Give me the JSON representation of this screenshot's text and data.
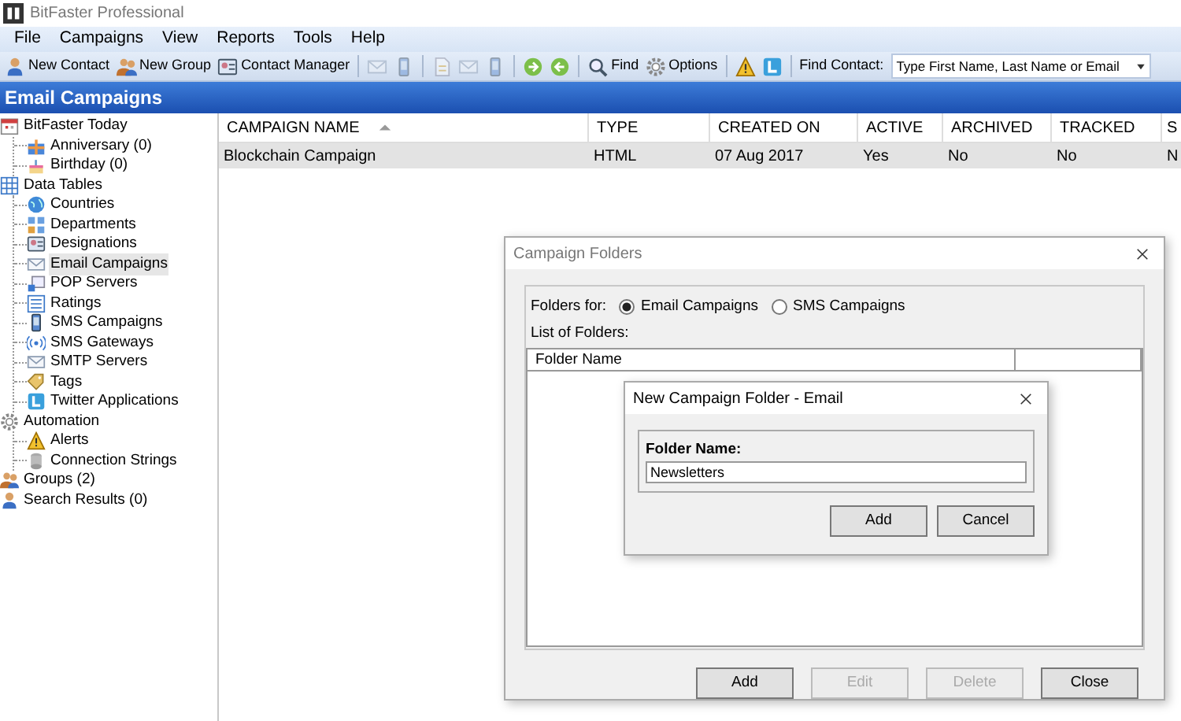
{
  "window": {
    "title": "BitFaster Professional"
  },
  "menu": [
    "File",
    "Campaigns",
    "View",
    "Reports",
    "Tools",
    "Help"
  ],
  "toolbar": [
    {
      "kind": "button",
      "label": "New Contact"
    },
    {
      "kind": "button",
      "label": "New Group"
    },
    {
      "kind": "button",
      "label": "Contact Manager"
    },
    {
      "kind": "separator"
    },
    {
      "kind": "icon",
      "disabled": true
    },
    {
      "kind": "icon",
      "disabled": true
    },
    {
      "kind": "separator"
    },
    {
      "kind": "icon",
      "disabled": true
    },
    {
      "kind": "icon",
      "disabled": true
    },
    {
      "kind": "icon",
      "disabled": true
    },
    {
      "kind": "separator"
    },
    {
      "kind": "icon",
      "disabled": false
    },
    {
      "kind": "icon",
      "disabled": false
    },
    {
      "kind": "separator"
    },
    {
      "kind": "button",
      "label": "Find"
    },
    {
      "kind": "button",
      "label": "Options"
    },
    {
      "kind": "separator"
    },
    {
      "kind": "icon",
      "disabled": false
    },
    {
      "kind": "icon",
      "disabled": false
    },
    {
      "kind": "separator"
    }
  ],
  "find_contact": {
    "label": "Find Contact:",
    "value": "Type First Name, Last Name or Email"
  },
  "header": "Email Campaigns",
  "tree": [
    {
      "label": "BitFaster Today",
      "selected": false,
      "children": [
        {
          "label": "Anniversary (0)",
          "selected": false
        },
        {
          "label": "Birthday (0)",
          "selected": false
        }
      ]
    },
    {
      "label": "Data Tables",
      "selected": false,
      "children": [
        {
          "label": "Countries",
          "selected": false
        },
        {
          "label": "Departments",
          "selected": false
        },
        {
          "label": "Designations",
          "selected": false
        },
        {
          "label": "Email Campaigns",
          "selected": true
        },
        {
          "label": "POP Servers",
          "selected": false
        },
        {
          "label": "Ratings",
          "selected": false
        },
        {
          "label": "SMS Campaigns",
          "selected": false
        },
        {
          "label": "SMS Gateways",
          "selected": false
        },
        {
          "label": "SMTP Servers",
          "selected": false
        },
        {
          "label": "Tags",
          "selected": false
        },
        {
          "label": "Twitter Applications",
          "selected": false
        }
      ]
    },
    {
      "label": "Automation",
      "selected": false,
      "children": [
        {
          "label": "Alerts",
          "selected": false
        },
        {
          "label": "Connection Strings",
          "selected": false
        }
      ]
    },
    {
      "label": "Groups (2)",
      "selected": false
    },
    {
      "label": "Search Results (0)",
      "selected": false
    }
  ],
  "table": {
    "columns": [
      {
        "label": "CAMPAIGN NAME",
        "sorted": true
      },
      {
        "label": "TYPE",
        "sorted": false
      },
      {
        "label": "CREATED ON",
        "sorted": false
      },
      {
        "label": "ACTIVE",
        "sorted": false
      },
      {
        "label": "ARCHIVED",
        "sorted": false
      },
      {
        "label": "TRACKED",
        "sorted": false
      },
      {
        "label": "S",
        "sorted": false
      }
    ],
    "rows": [
      {
        "selected": true,
        "cells": [
          "Blockchain Campaign",
          "HTML",
          "07 Aug 2017",
          "Yes",
          "No",
          "No",
          "N"
        ]
      }
    ]
  },
  "folders_dialog": {
    "title": "Campaign Folders",
    "folders_for": "Folders for:",
    "options": [
      {
        "label": "Email Campaigns",
        "selected": true
      },
      {
        "label": "SMS Campaigns",
        "selected": false
      }
    ],
    "list_label": "List of Folders:",
    "list_columns": [
      "Folder Name"
    ],
    "buttons": [
      {
        "label": "Add",
        "disabled": false
      },
      {
        "label": "Edit",
        "disabled": true
      },
      {
        "label": "Delete",
        "disabled": true
      },
      {
        "label": "Close",
        "disabled": false
      }
    ]
  },
  "new_folder_dialog": {
    "title": "New Campaign Folder - Email",
    "field_label": "Folder Name:",
    "value": "Newsletters",
    "buttons": [
      {
        "label": "Add",
        "disabled": false
      },
      {
        "label": "Cancel",
        "disabled": false
      }
    ]
  }
}
